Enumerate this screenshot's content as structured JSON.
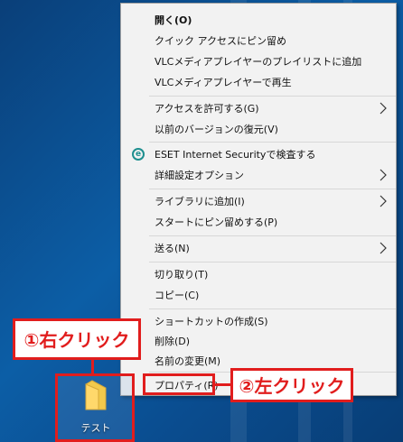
{
  "context_menu": {
    "items": [
      {
        "label": "開く(O)",
        "bold": true
      },
      {
        "label": "クイック アクセスにピン留め"
      },
      {
        "label": "VLCメディアプレイヤーのプレイリストに追加"
      },
      {
        "label": "VLCメディアプレイヤーで再生"
      },
      {
        "label": "アクセスを許可する(G)",
        "submenu": true
      },
      {
        "label": "以前のバージョンの復元(V)"
      },
      {
        "label": "ESET Internet Securityで検査する",
        "icon": "eset-icon"
      },
      {
        "label": "詳細設定オプション",
        "submenu": true
      },
      {
        "label": "ライブラリに追加(I)",
        "submenu": true
      },
      {
        "label": "スタートにピン留めする(P)"
      },
      {
        "label": "送る(N)",
        "submenu": true
      },
      {
        "label": "切り取り(T)"
      },
      {
        "label": "コピー(C)"
      },
      {
        "label": "ショートカットの作成(S)"
      },
      {
        "label": "削除(D)"
      },
      {
        "label": "名前の変更(M)"
      },
      {
        "label": "プロパティ(R)"
      }
    ]
  },
  "annotations": {
    "step1": "①右クリック",
    "step2": "②左クリック"
  },
  "desktop": {
    "folder_label": "テスト"
  },
  "colors": {
    "annotation_red": "#e11d1d",
    "menu_bg": "#f2f2f2",
    "desktop_blue": "#0c5ea6",
    "folder_yellow": "#f2c94c"
  }
}
